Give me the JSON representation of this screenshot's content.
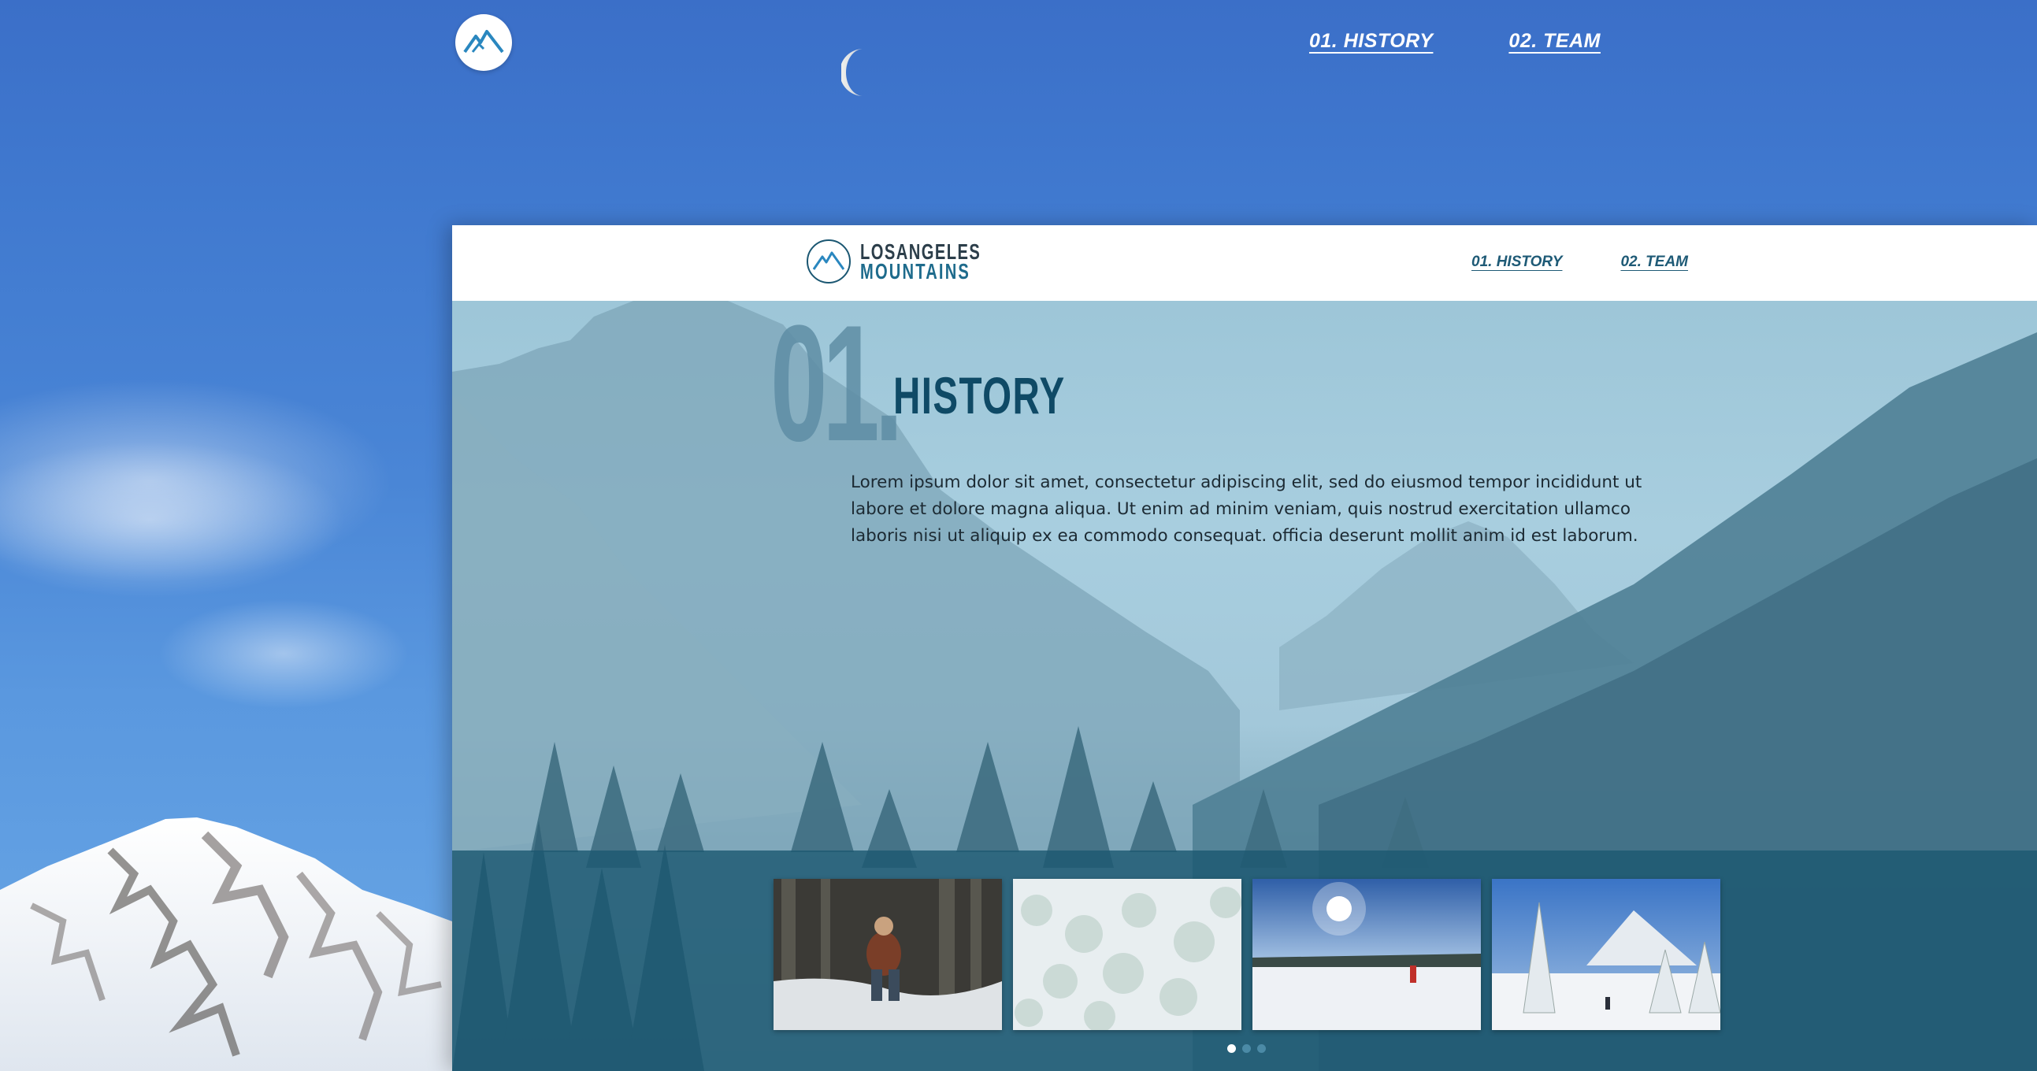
{
  "outer_nav": {
    "history": "01. HISTORY",
    "team": "02. TEAM"
  },
  "brand": {
    "line1": "LOSANGELES",
    "line2": "MOUNTAINS"
  },
  "frame_nav": {
    "history": "01. HISTORY",
    "team": "02. TEAM"
  },
  "section": {
    "number": "01.",
    "title": "HISTORY",
    "body": "Lorem ipsum dolor sit amet, consectetur adipiscing elit, sed do eiusmod tempor incididunt ut labore et dolore magna aliqua. Ut enim ad minim veniam, quis nostrud exercitation ullamco laboris nisi ut aliquip ex ea commodo consequat. officia deserunt mollit anim id est laborum."
  },
  "gallery": {
    "thumbnails": [
      "hiker-in-snowy-forest",
      "frosted-treetops-aerial",
      "sun-over-snowfield",
      "snowy-peak-and-trees"
    ],
    "active_dot": 0,
    "dot_count": 3
  },
  "colors": {
    "sky": "#3b6fc8",
    "brand_dark": "#0f4a66",
    "band": "#1c5870",
    "link": "#1e5a76"
  }
}
